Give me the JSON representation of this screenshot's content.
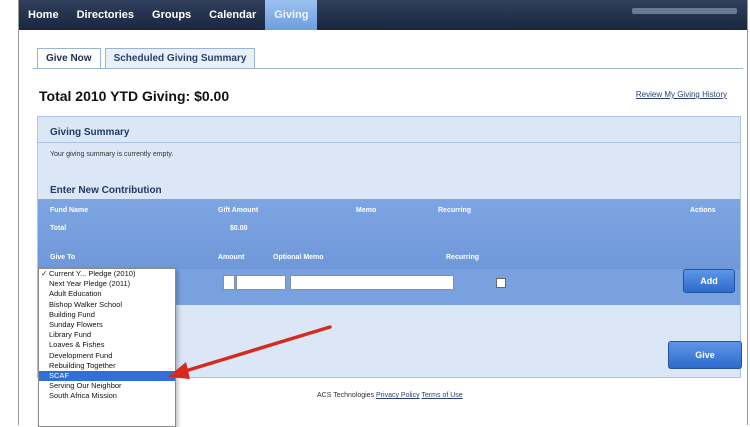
{
  "nav": {
    "items": [
      {
        "label": "Home",
        "active": false
      },
      {
        "label": "Directories",
        "active": false
      },
      {
        "label": "Groups",
        "active": false
      },
      {
        "label": "Calendar",
        "active": false
      },
      {
        "label": "Giving",
        "active": true
      }
    ]
  },
  "tabs": [
    {
      "label": "Give Now",
      "active": true
    },
    {
      "label": "Scheduled Giving Summary",
      "active": false
    }
  ],
  "header": {
    "total": "Total 2010 YTD Giving: $0.00",
    "review_link": "Review My Giving History"
  },
  "giving_summary": {
    "title": "Giving Summary",
    "empty_text": "Your giving summary is currently empty."
  },
  "contribution": {
    "title": "Enter New Contribution",
    "columns": [
      "Fund Name",
      "Gift Amount",
      "Memo",
      "Recurring",
      "Actions"
    ],
    "total_label": "Total",
    "total_value": "$0.00",
    "form_labels": {
      "give_to": "Give To",
      "amount": "Amount",
      "memo": "Optional Memo",
      "recurring": "Recurring"
    },
    "add_label": "Add",
    "give_label": "Give"
  },
  "dropdown": {
    "options": [
      "Current Y... Pledge (2010)",
      "Next Year Pledge (2011)",
      "Adult Education",
      "Bishop Walker School",
      "Building Fund",
      "Sunday Flowers",
      "Library Fund",
      "Loaves & Fishes",
      "Development Fund",
      "Rebuilding Together",
      "SCAF",
      "Serving Our Neighbor",
      "South Africa Mission"
    ],
    "checked_index": 0,
    "selected_index": 10
  },
  "footer": {
    "company": "ACS Technologies",
    "privacy": "Privacy Policy",
    "terms": "Terms of Use"
  },
  "colors": {
    "nav_bg": "#1b2740",
    "accent": "#2f6fd7",
    "panel_bg": "#dbe6f6",
    "table_header": "#7ea5e2",
    "arrow": "#d52b1e"
  }
}
